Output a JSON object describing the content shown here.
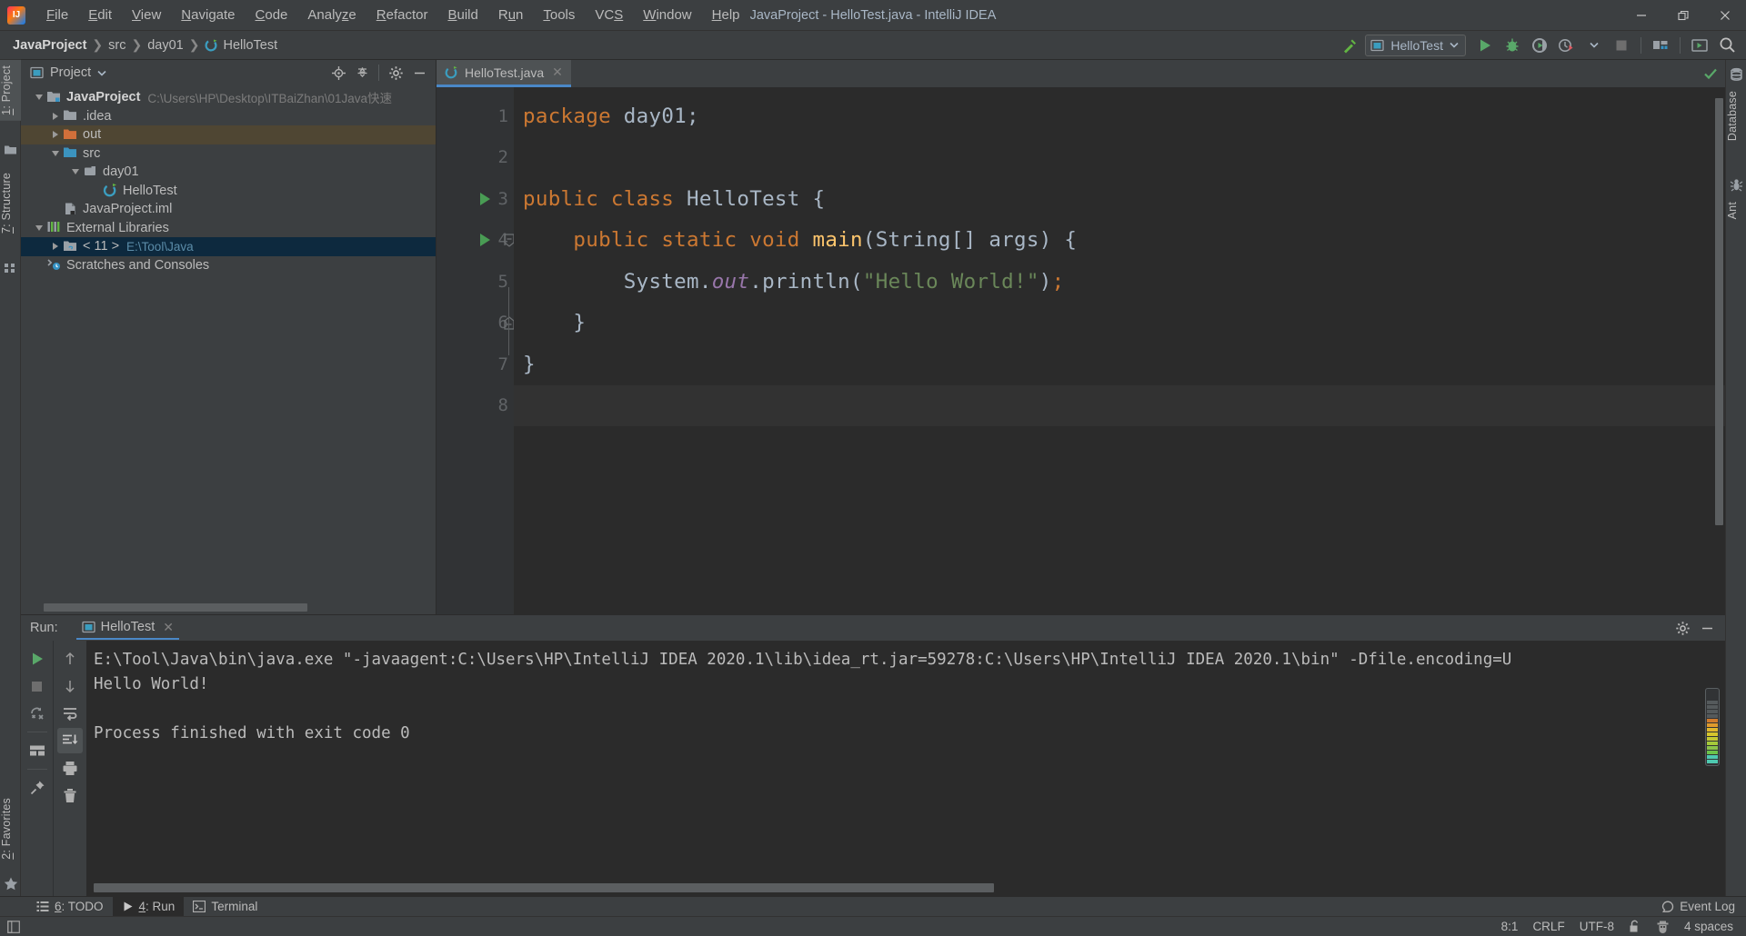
{
  "window": {
    "title": "JavaProject - HelloTest.java - IntelliJ IDEA",
    "logo_text": "IJ",
    "minimize": "−",
    "restore": "❐",
    "close": "✕"
  },
  "menu": [
    {
      "label": "File",
      "mnemonic": "F"
    },
    {
      "label": "Edit",
      "mnemonic": "E"
    },
    {
      "label": "View",
      "mnemonic": "V"
    },
    {
      "label": "Navigate",
      "mnemonic": "N"
    },
    {
      "label": "Code",
      "mnemonic": "C"
    },
    {
      "label": "Analyze",
      "mnemonic": "z"
    },
    {
      "label": "Refactor",
      "mnemonic": "R"
    },
    {
      "label": "Build",
      "mnemonic": "B"
    },
    {
      "label": "Run",
      "mnemonic": "u"
    },
    {
      "label": "Tools",
      "mnemonic": "T"
    },
    {
      "label": "VCS",
      "mnemonic": "S"
    },
    {
      "label": "Window",
      "mnemonic": "W"
    },
    {
      "label": "Help",
      "mnemonic": "H"
    }
  ],
  "breadcrumbs": [
    {
      "label": "JavaProject",
      "icon": "project-icon"
    },
    {
      "label": "src",
      "icon": "folder-icon"
    },
    {
      "label": "day01",
      "icon": "package-icon"
    },
    {
      "label": "HelloTest",
      "icon": "class-icon"
    }
  ],
  "toolbar": {
    "build_icon": "hammer-icon",
    "run_config": "HelloTest",
    "run_config_icon": "application-icon",
    "dropdown_icon": "chevron-down-icon",
    "run_icon": "run-icon",
    "debug_icon": "debug-icon",
    "coverage_icon": "run-with-coverage-icon",
    "profiler_icon": "profiler-icon",
    "stop_icon": "stop-icon",
    "project_structure_icon": "project-structure-icon",
    "update_icon": "update-running-app-icon",
    "search_icon": "search-everywhere-icon"
  },
  "left_strip": [
    {
      "label": "1: Project",
      "mnemonic": "1",
      "icon": "project-folder-icon",
      "active": true
    },
    {
      "label": "7: Structure",
      "mnemonic": "7",
      "icon": "structure-icon",
      "active": false
    },
    {
      "label": "2: Favorites",
      "mnemonic": "2",
      "icon": "star-icon",
      "active": false
    }
  ],
  "right_strip": [
    {
      "label": "Database",
      "icon": "database-icon"
    },
    {
      "label": "Ant",
      "icon": "ant-icon"
    }
  ],
  "project_panel": {
    "title": "Project",
    "dropdown_icon": "chevron-down-icon",
    "actions": [
      {
        "name": "locate-icon",
        "title": "Select Opened File"
      },
      {
        "name": "collapse-all-icon",
        "title": "Collapse All"
      },
      {
        "name": "settings-gear-icon",
        "title": "Settings"
      },
      {
        "name": "hide-icon",
        "title": "Hide"
      }
    ],
    "tree": [
      {
        "label": "JavaProject",
        "sub": "C:\\Users\\HP\\Desktop\\ITBaiZhan\\01Java快速",
        "indent": 0,
        "twist": "down",
        "icon": "module-icon",
        "bold": true,
        "state": "none"
      },
      {
        "label": ".idea",
        "sub": "",
        "indent": 1,
        "twist": "right",
        "icon": "folder-icon",
        "bold": false,
        "state": "none"
      },
      {
        "label": "out",
        "sub": "",
        "indent": 1,
        "twist": "right",
        "icon": "folder-orange-icon",
        "bold": false,
        "state": "amber"
      },
      {
        "label": "src",
        "sub": "",
        "indent": 1,
        "twist": "down",
        "icon": "source-folder-icon",
        "bold": false,
        "state": "none"
      },
      {
        "label": "day01",
        "sub": "",
        "indent": 2,
        "twist": "down",
        "icon": "package-icon",
        "bold": false,
        "state": "none"
      },
      {
        "label": "HelloTest",
        "sub": "",
        "indent": 3,
        "twist": "none",
        "icon": "class-runnable-icon",
        "bold": false,
        "state": "none"
      },
      {
        "label": "JavaProject.iml",
        "sub": "",
        "indent": 1,
        "twist": "none",
        "icon": "iml-file-icon",
        "bold": false,
        "state": "none"
      },
      {
        "label": "External Libraries",
        "sub": "",
        "indent": 0,
        "twist": "down",
        "icon": "libraries-icon",
        "bold": false,
        "state": "none"
      },
      {
        "label": "< 11 >",
        "sub": "E:\\Tool\\Java",
        "indent": 1,
        "twist": "right",
        "icon": "jdk-icon",
        "bold": false,
        "state": "blue"
      },
      {
        "label": "Scratches and Consoles",
        "sub": "",
        "indent": 0,
        "twist": "none",
        "icon": "scratches-icon",
        "bold": false,
        "state": "none"
      }
    ]
  },
  "editor": {
    "tab": {
      "label": "HelloTest.java",
      "icon": "java-class-icon",
      "close": "✕"
    },
    "inspection_status_icon": "inspections-ok-icon",
    "lines": [
      {
        "n": "1",
        "run_marker": false,
        "fold": "none",
        "current": false
      },
      {
        "n": "2",
        "run_marker": false,
        "fold": "none",
        "current": false
      },
      {
        "n": "3",
        "run_marker": true,
        "fold": "none",
        "current": false
      },
      {
        "n": "4",
        "run_marker": true,
        "fold": "start",
        "current": false
      },
      {
        "n": "5",
        "run_marker": false,
        "fold": "mid",
        "current": false
      },
      {
        "n": "6",
        "run_marker": false,
        "fold": "end",
        "current": false
      },
      {
        "n": "7",
        "run_marker": false,
        "fold": "none",
        "current": false
      },
      {
        "n": "8",
        "run_marker": false,
        "fold": "none",
        "current": true
      }
    ],
    "code_text": [
      "package day01;",
      "",
      "public class HelloTest {",
      "    public static void main(String[] args) {",
      "        System.out.println(\"Hello World!\");",
      "    }",
      "}",
      ""
    ]
  },
  "run_window": {
    "label": "Run:",
    "tab": {
      "label": "HelloTest",
      "icon": "application-icon",
      "close": "✕"
    },
    "header_actions": [
      {
        "name": "settings-gear-icon"
      },
      {
        "name": "hide-icon"
      }
    ],
    "side_buttons": [
      {
        "name": "rerun-button",
        "icon": "run-icon"
      },
      {
        "name": "stop-button",
        "icon": "stop-icon"
      },
      {
        "name": "rerun-failed-button",
        "icon": "rerun-failed-icon"
      },
      {
        "name": "layout-button",
        "icon": "layout-icon"
      },
      {
        "name": "pin-button",
        "icon": "pin-icon"
      }
    ],
    "side_buttons2": [
      {
        "name": "prev-occurrence-button",
        "icon": "arrow-up-icon"
      },
      {
        "name": "next-occurrence-button",
        "icon": "arrow-down-icon"
      },
      {
        "name": "soft-wrap-button",
        "icon": "soft-wrap-icon"
      },
      {
        "name": "scroll-to-end-button",
        "icon": "scroll-to-end-icon",
        "active": true
      },
      {
        "name": "print-button",
        "icon": "print-icon"
      },
      {
        "name": "clear-all-button",
        "icon": "trash-icon"
      }
    ],
    "console": [
      "E:\\Tool\\Java\\bin\\java.exe \"-javaagent:C:\\Users\\HP\\IntelliJ IDEA 2020.1\\lib\\idea_rt.jar=59278:C:\\Users\\HP\\IntelliJ IDEA 2020.1\\bin\" -Dfile.encoding=U",
      "Hello World!",
      "",
      "Process finished with exit code 0"
    ]
  },
  "tool_strip": [
    {
      "label": "6: TODO",
      "mnemonic": "6",
      "icon": "todo-icon",
      "active": false
    },
    {
      "label": "4: Run",
      "mnemonic": "4",
      "icon": "run-icon",
      "active": true
    },
    {
      "label": "Terminal",
      "mnemonic": "",
      "icon": "terminal-icon",
      "active": false
    }
  ],
  "event_log": {
    "label": "Event Log",
    "icon": "balloon-icon"
  },
  "statusbar": {
    "left_icon": "show-tool-windows-icon",
    "caret": "8:1",
    "line_sep": "CRLF",
    "encoding": "UTF-8",
    "lock_icon": "unlocked-icon",
    "inspection_icon": "hector-icon",
    "indent": "4 spaces"
  },
  "colors": {
    "accent_blue": "#4a88c7",
    "keyword_orange": "#cc7832",
    "string_green": "#6a8759",
    "method_yellow": "#ffc66d",
    "field_purple": "#9876aa",
    "text_gray": "#a9b7c6",
    "run_green": "#499c54",
    "panel_bg": "#3c3f41",
    "editor_bg": "#2b2b2b",
    "selection_blue": "#0d293e",
    "selection_amber": "#4f4633"
  }
}
